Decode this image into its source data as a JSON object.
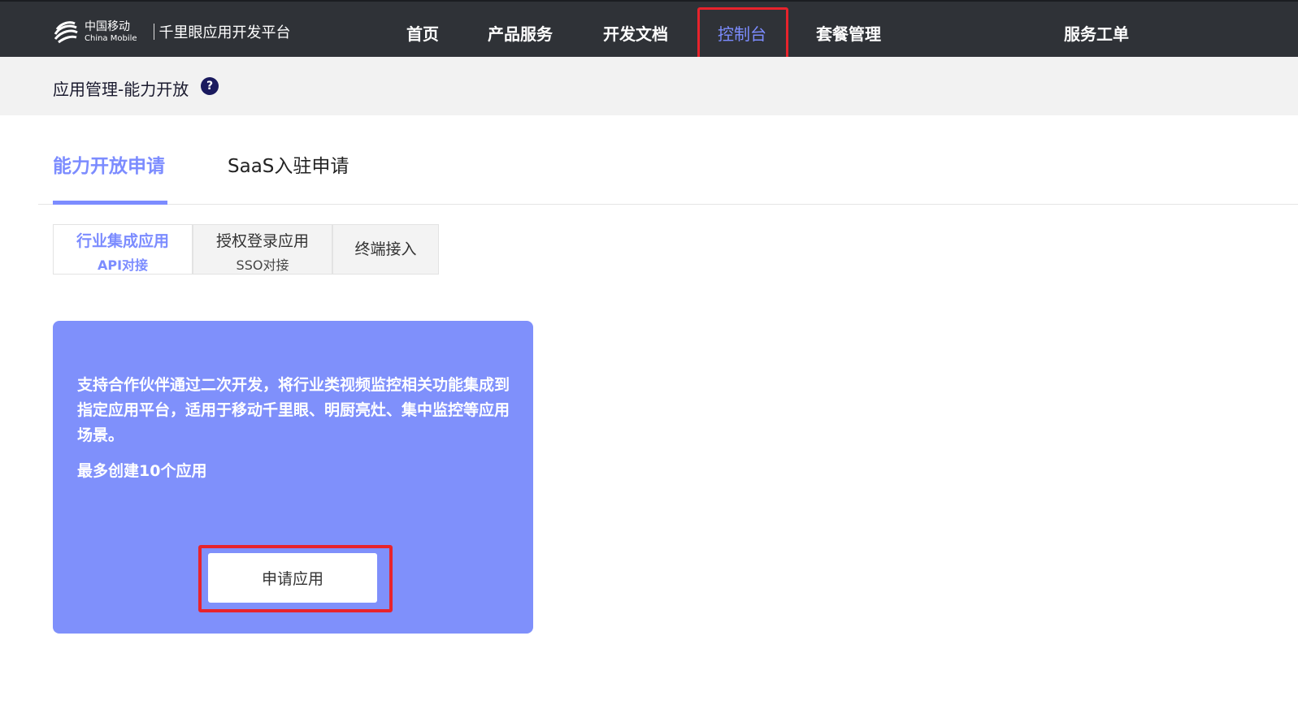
{
  "header": {
    "logo": {
      "cn": "中国移动",
      "en": "China Mobile",
      "platform": "千里眼应用开发平台"
    },
    "nav": [
      {
        "label": "首页"
      },
      {
        "label": "产品服务"
      },
      {
        "label": "开发文档"
      },
      {
        "label": "控制台",
        "active": true
      },
      {
        "label": "套餐管理"
      },
      {
        "label": "服务工单"
      }
    ]
  },
  "breadcrumb": {
    "title": "应用管理-能力开放",
    "help_glyph": "?"
  },
  "tabs": [
    {
      "label": "能力开放申请",
      "active": true
    },
    {
      "label": "SaaS入驻申请"
    }
  ],
  "segments": [
    {
      "main": "行业集成应用",
      "sub": "API对接",
      "active": true
    },
    {
      "main": "授权登录应用",
      "sub": "SSO对接"
    },
    {
      "main": "终端接入"
    }
  ],
  "card": {
    "description": "支持合作伙伴通过二次开发，将行业类视频监控相关功能集成到指定应用平台，适用于移动千里眼、明厨亮灶、集中监控等应用场景。",
    "limit": "最多创建10个应用",
    "button_label": "申请应用"
  },
  "colors": {
    "topbar": "#2f3237",
    "accent": "#7c8cff",
    "card": "#7f90fb",
    "highlight": "#e8232c"
  }
}
